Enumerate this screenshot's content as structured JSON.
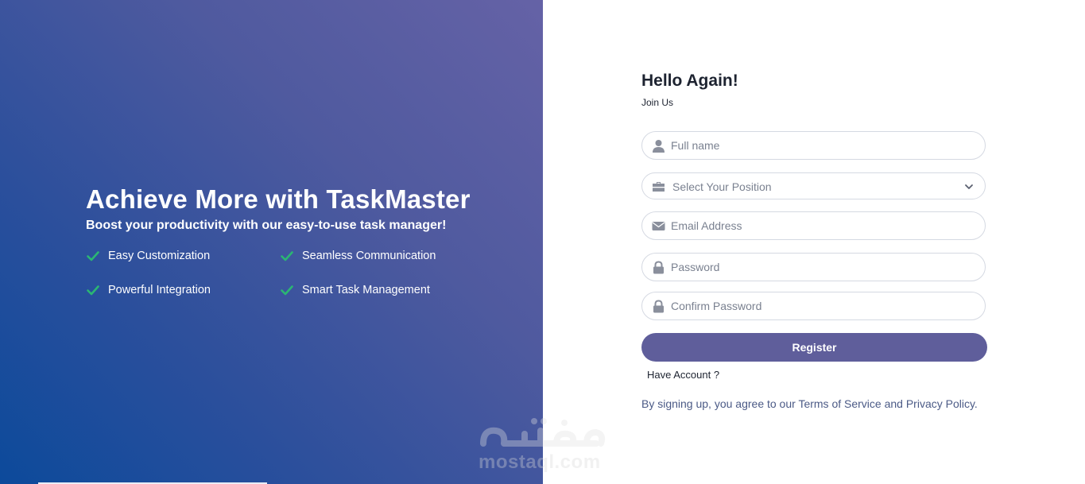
{
  "hero": {
    "title": "Achieve More with TaskMaster",
    "subtitle": "Boost your productivity with our easy-to-use task manager!",
    "features": [
      "Easy Customization",
      "Seamless Communication",
      "Powerful Integration",
      "Smart Task Management"
    ]
  },
  "form": {
    "title": "Hello Again!",
    "subtitle": "Join Us",
    "fullname_placeholder": "Full name",
    "position_select": "Select Your Position",
    "email_placeholder": "Email Address",
    "password_placeholder": "Password",
    "confirm_password_placeholder": "Confirm Password",
    "register_label": "Register",
    "have_account": "Have Account ?",
    "legal_prefix": "By signing up, you agree to our ",
    "terms_link": "Terms of Service",
    "legal_and": " and ",
    "privacy_link": "Privacy Policy",
    "legal_suffix": "."
  },
  "watermark": {
    "text": "mostaql.com"
  },
  "colors": {
    "accent": "#5f5e9b",
    "check": "#2bb673",
    "gradient_start": "#0c4a9b",
    "gradient_end": "#6562a6"
  },
  "icons": {
    "fullname": "user-icon",
    "position": "briefcase-icon",
    "email": "envelope-icon",
    "password": "lock-icon",
    "confirm_password": "lock-icon",
    "select": "chevron-down-icon",
    "feature": "check-icon"
  }
}
